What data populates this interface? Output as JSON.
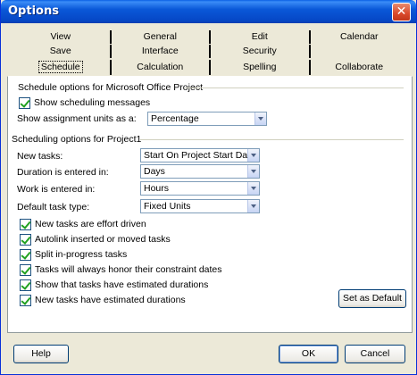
{
  "window": {
    "title": "Options",
    "close_glyph": "✕"
  },
  "tabs": {
    "row1": [
      "View",
      "General",
      "Edit",
      "Calendar"
    ],
    "row2": [
      "Save",
      "Interface",
      "Security",
      ""
    ],
    "row3": [
      "Schedule",
      "Calculation",
      "Spelling",
      "Collaborate"
    ],
    "selected": "Schedule"
  },
  "schedule_options": {
    "group_title": "Schedule options for Microsoft Office Project",
    "show_scheduling_messages": {
      "label": "Show scheduling messages",
      "checked": true
    },
    "assignment_units_label": "Show assignment units as a:",
    "assignment_units_value": "Percentage"
  },
  "project_options": {
    "group_title": "Scheduling options for Project1",
    "new_tasks_label": "New tasks:",
    "new_tasks_value": "Start On Project Start Date",
    "duration_label": "Duration is entered in:",
    "duration_value": "Days",
    "work_label": "Work is entered in:",
    "work_value": "Hours",
    "task_type_label": "Default task type:",
    "task_type_value": "Fixed Units",
    "checkboxes": [
      {
        "label": "New tasks are effort driven",
        "checked": true
      },
      {
        "label": "Autolink inserted or moved tasks",
        "checked": true
      },
      {
        "label": "Split in-progress tasks",
        "checked": true
      },
      {
        "label": "Tasks will always honor their constraint dates",
        "checked": true
      },
      {
        "label": "Show that tasks have estimated durations",
        "checked": true
      },
      {
        "label": "New tasks have estimated durations",
        "checked": true
      }
    ],
    "set_default_label": "Set as Default"
  },
  "footer": {
    "help_label": "Help",
    "ok_label": "OK",
    "cancel_label": "Cancel"
  },
  "colors": {
    "titlebar": "#0a58d8",
    "dialog_bg": "#ece9d8",
    "panel_bg": "#ffffff",
    "check": "#21a121"
  }
}
